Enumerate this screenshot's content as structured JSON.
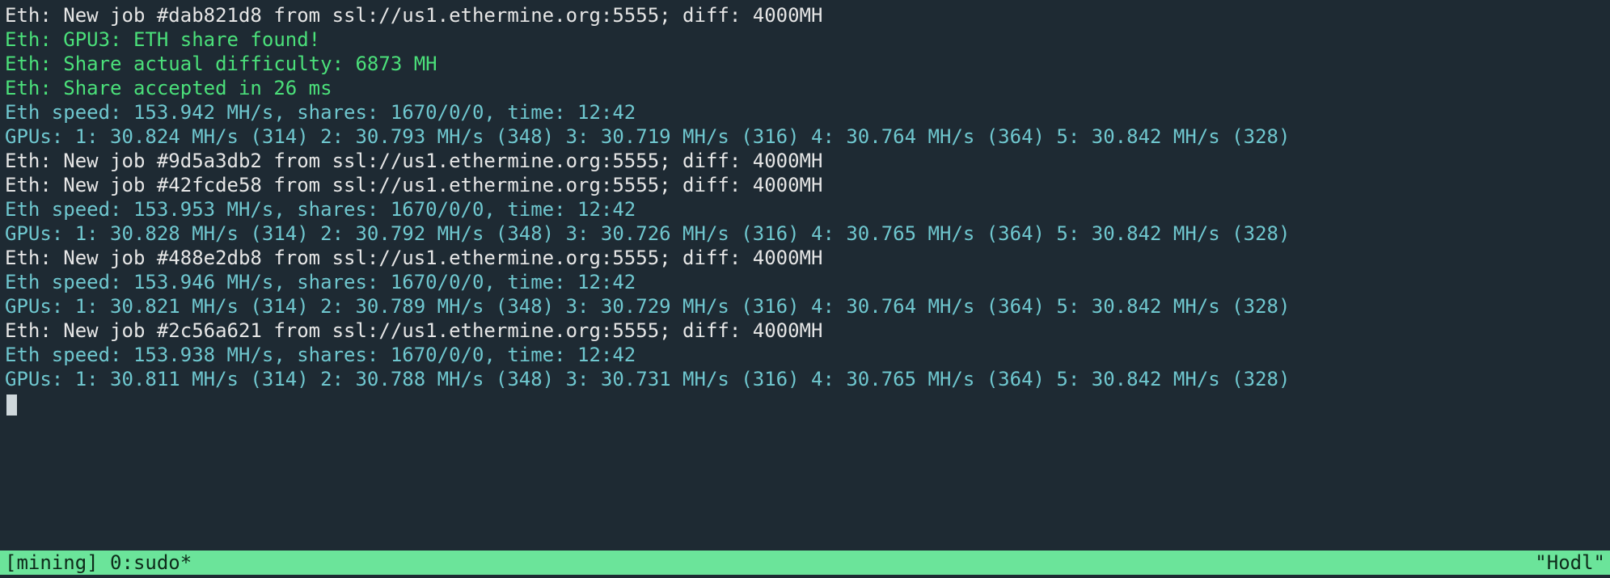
{
  "colors": {
    "bg": "#1e2a33",
    "white": "#e6e6e6",
    "green": "#4be07a",
    "cyan": "#6fc7cf",
    "status_bg": "#6be49a",
    "status_fg": "#0e2a1a"
  },
  "lines": [
    {
      "color": "white",
      "text": "Eth: New job #dab821d8 from ssl://us1.ethermine.org:5555; diff: 4000MH"
    },
    {
      "color": "green",
      "text": "Eth: GPU3: ETH share found!"
    },
    {
      "color": "green",
      "text": "Eth: Share actual difficulty: 6873 MH"
    },
    {
      "color": "green",
      "text": "Eth: Share accepted in 26 ms"
    },
    {
      "color": "cyan",
      "text": "Eth speed: 153.942 MH/s, shares: 1670/0/0, time: 12:42"
    },
    {
      "color": "cyan",
      "text": "GPUs: 1: 30.824 MH/s (314) 2: 30.793 MH/s (348) 3: 30.719 MH/s (316) 4: 30.764 MH/s (364) 5: 30.842 MH/s (328)"
    },
    {
      "color": "white",
      "text": "Eth: New job #9d5a3db2 from ssl://us1.ethermine.org:5555; diff: 4000MH"
    },
    {
      "color": "white",
      "text": "Eth: New job #42fcde58 from ssl://us1.ethermine.org:5555; diff: 4000MH"
    },
    {
      "color": "cyan",
      "text": "Eth speed: 153.953 MH/s, shares: 1670/0/0, time: 12:42"
    },
    {
      "color": "cyan",
      "text": "GPUs: 1: 30.828 MH/s (314) 2: 30.792 MH/s (348) 3: 30.726 MH/s (316) 4: 30.765 MH/s (364) 5: 30.842 MH/s (328)"
    },
    {
      "color": "white",
      "text": "Eth: New job #488e2db8 from ssl://us1.ethermine.org:5555; diff: 4000MH"
    },
    {
      "color": "cyan",
      "text": "Eth speed: 153.946 MH/s, shares: 1670/0/0, time: 12:42"
    },
    {
      "color": "cyan",
      "text": "GPUs: 1: 30.821 MH/s (314) 2: 30.789 MH/s (348) 3: 30.729 MH/s (316) 4: 30.764 MH/s (364) 5: 30.842 MH/s (328)"
    },
    {
      "color": "white",
      "text": "Eth: New job #2c56a621 from ssl://us1.ethermine.org:5555; diff: 4000MH"
    },
    {
      "color": "cyan",
      "text": "Eth speed: 153.938 MH/s, shares: 1670/0/0, time: 12:42"
    },
    {
      "color": "cyan",
      "text": "GPUs: 1: 30.811 MH/s (314) 2: 30.788 MH/s (348) 3: 30.731 MH/s (316) 4: 30.765 MH/s (364) 5: 30.842 MH/s (328)"
    }
  ],
  "statusbar": {
    "left": "[mining] 0:sudo*",
    "right": "\"Hodl\""
  }
}
